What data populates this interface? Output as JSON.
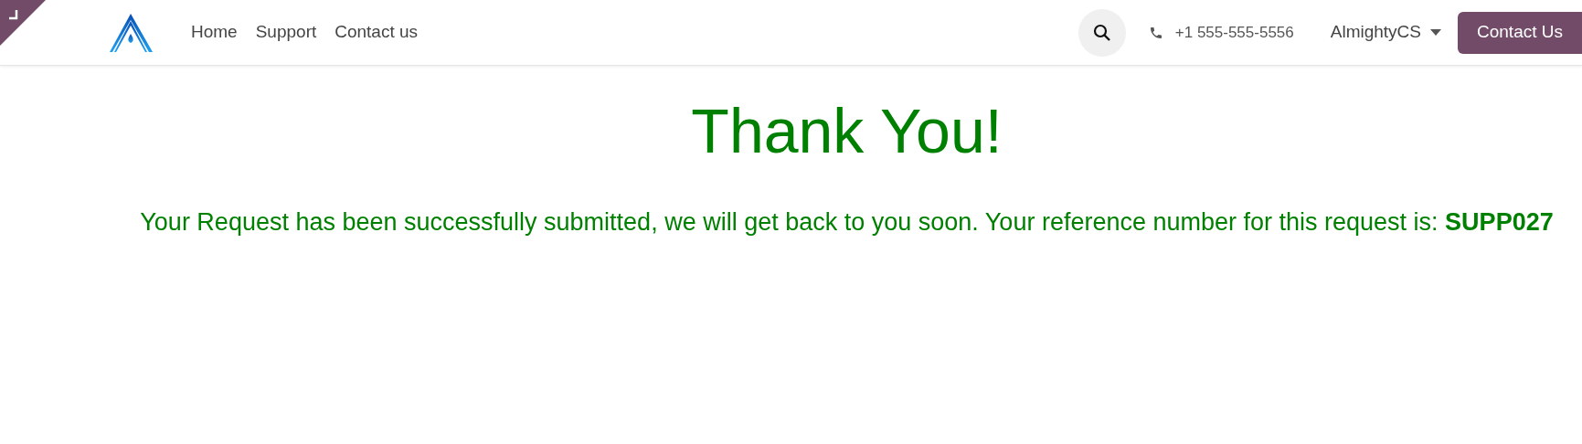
{
  "nav": {
    "links": [
      {
        "label": "Home"
      },
      {
        "label": "Support"
      },
      {
        "label": "Contact us"
      }
    ],
    "phone": "+1 555-555-5556",
    "user": "AlmightyCS",
    "cta": "Contact Us"
  },
  "heading": "Thank You!",
  "message": "Your Request has been successfully submitted, we will get back to you soon. Your reference number for this request is: **SUPP027**"
}
